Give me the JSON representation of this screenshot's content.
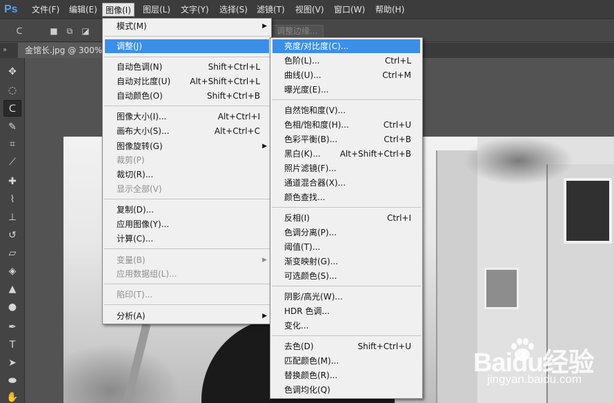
{
  "app": {
    "logo": "Ps"
  },
  "menubar": [
    {
      "label": "文件(F)"
    },
    {
      "label": "编辑(E)"
    },
    {
      "label": "图像(I)"
    },
    {
      "label": "图层(L)"
    },
    {
      "label": "文字(Y)"
    },
    {
      "label": "选择(S)"
    },
    {
      "label": "滤镜(T)"
    },
    {
      "label": "视图(V)"
    },
    {
      "label": "窗口(W)"
    },
    {
      "label": "帮助(H)"
    }
  ],
  "options_bar": {
    "refine_edge_label": "调整边缘..."
  },
  "document_tab": {
    "label": "金馆长.jpg @ 300%("
  },
  "image_menu": {
    "items": [
      {
        "label": "模式(M)",
        "shortcut": "",
        "submenu": true
      },
      {
        "label": "调整(J)",
        "shortcut": "",
        "submenu": true
      },
      {
        "label": "自动色调(N)",
        "shortcut": "Shift+Ctrl+L"
      },
      {
        "label": "自动对比度(U)",
        "shortcut": "Alt+Shift+Ctrl+L"
      },
      {
        "label": "自动颜色(O)",
        "shortcut": "Shift+Ctrl+B"
      },
      {
        "label": "图像大小(I)...",
        "shortcut": "Alt+Ctrl+I"
      },
      {
        "label": "画布大小(S)...",
        "shortcut": "Alt+Ctrl+C"
      },
      {
        "label": "图像旋转(G)",
        "shortcut": "",
        "submenu": true
      },
      {
        "label": "裁剪(P)",
        "shortcut": "",
        "disabled": true
      },
      {
        "label": "裁切(R)...",
        "shortcut": ""
      },
      {
        "label": "显示全部(V)",
        "shortcut": "",
        "disabled": true
      },
      {
        "label": "复制(D)...",
        "shortcut": ""
      },
      {
        "label": "应用图像(Y)...",
        "shortcut": ""
      },
      {
        "label": "计算(C)...",
        "shortcut": ""
      },
      {
        "label": "变量(B)",
        "shortcut": "",
        "disabled": true,
        "submenu": true
      },
      {
        "label": "应用数据组(L)...",
        "shortcut": "",
        "disabled": true
      },
      {
        "label": "陷印(T)...",
        "shortcut": "",
        "disabled": true
      },
      {
        "label": "分析(A)",
        "shortcut": "",
        "submenu": true
      }
    ]
  },
  "adjust_menu": {
    "items": [
      {
        "label": "亮度/对比度(C)...",
        "shortcut": ""
      },
      {
        "label": "色阶(L)...",
        "shortcut": "Ctrl+L"
      },
      {
        "label": "曲线(U)...",
        "shortcut": "Ctrl+M"
      },
      {
        "label": "曝光度(E)...",
        "shortcut": ""
      },
      {
        "label": "自然饱和度(V)...",
        "shortcut": ""
      },
      {
        "label": "色相/饱和度(H)...",
        "shortcut": "Ctrl+U"
      },
      {
        "label": "色彩平衡(B)...",
        "shortcut": "Ctrl+B"
      },
      {
        "label": "黑白(K)...",
        "shortcut": "Alt+Shift+Ctrl+B"
      },
      {
        "label": "照片滤镜(F)...",
        "shortcut": ""
      },
      {
        "label": "通道混合器(X)...",
        "shortcut": ""
      },
      {
        "label": "颜色查找...",
        "shortcut": ""
      },
      {
        "label": "反相(I)",
        "shortcut": "Ctrl+I"
      },
      {
        "label": "色调分离(P)...",
        "shortcut": ""
      },
      {
        "label": "阈值(T)...",
        "shortcut": ""
      },
      {
        "label": "渐变映射(G)...",
        "shortcut": ""
      },
      {
        "label": "可选颜色(S)...",
        "shortcut": ""
      },
      {
        "label": "阴影/高光(W)...",
        "shortcut": ""
      },
      {
        "label": "HDR 色调...",
        "shortcut": ""
      },
      {
        "label": "变化...",
        "shortcut": ""
      },
      {
        "label": "去色(D)",
        "shortcut": "Shift+Ctrl+U"
      },
      {
        "label": "匹配颜色(M)...",
        "shortcut": ""
      },
      {
        "label": "替换颜色(R)...",
        "shortcut": ""
      },
      {
        "label": "色调均化(Q)",
        "shortcut": ""
      }
    ]
  },
  "watermark": {
    "brand": "Baidu经验",
    "url": "jingyan.baidu.com"
  },
  "colors": {
    "highlight": "#3b8fe8",
    "menu_bg": "#f0f0f0",
    "app_bg": "#535353",
    "logo_blue": "#4aa3ff"
  }
}
